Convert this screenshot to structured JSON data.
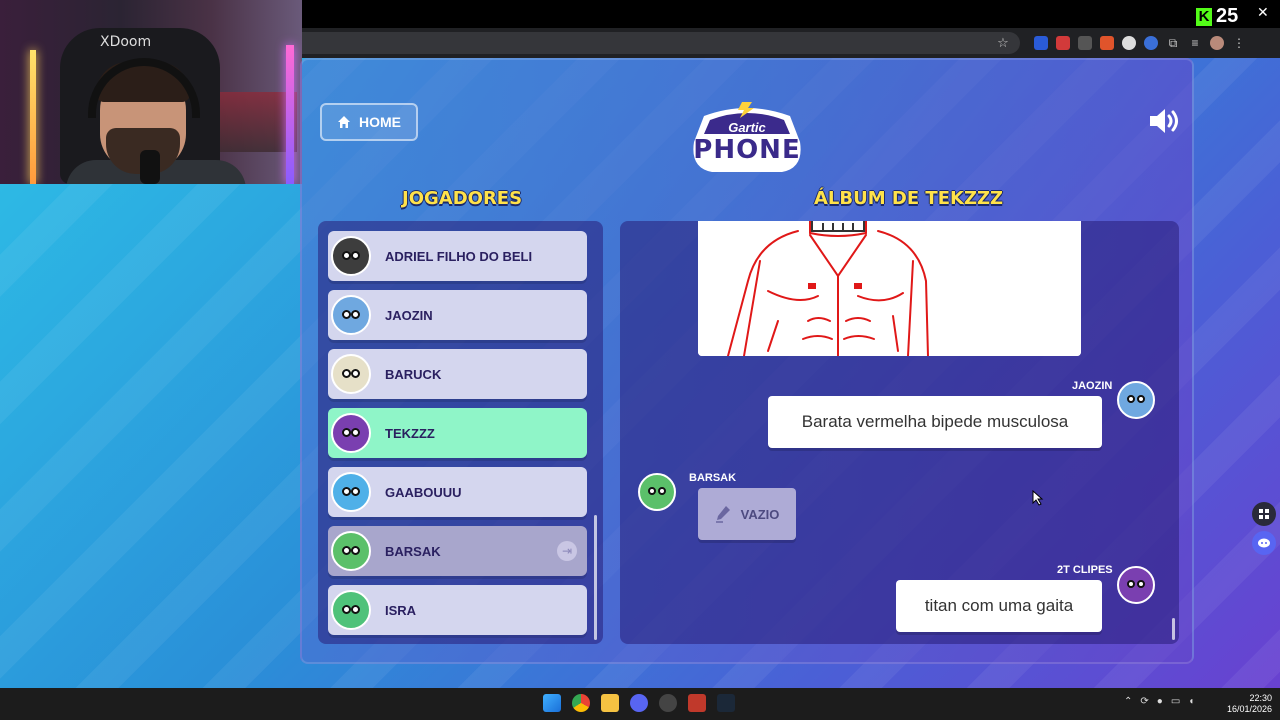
{
  "browser": {
    "kick_count": "25",
    "close_glyph": "✕"
  },
  "webcam": {
    "chair_brand": "XDoom"
  },
  "game": {
    "home_label": "HOME",
    "logo_top": "Gartic",
    "logo_main": "PHONE",
    "players_title": "JOGADORES",
    "album_title": "ÁLBUM DE TEKZZZ"
  },
  "players": [
    {
      "name": "ADRIEL FILHO DO BELI",
      "color": "#3d3d3d",
      "state": "normal"
    },
    {
      "name": "JAOZIN",
      "color": "#6fa8e0",
      "state": "normal"
    },
    {
      "name": "BARUCK",
      "color": "#e6e0c8",
      "state": "normal"
    },
    {
      "name": "TEKZZZ",
      "color": "#7a3fb0",
      "state": "active"
    },
    {
      "name": "GAABOUUU",
      "color": "#4fb0e8",
      "state": "normal"
    },
    {
      "name": "BARSAK",
      "color": "#5bc06a",
      "state": "disconnected"
    },
    {
      "name": "ISRA",
      "color": "#4fc27a",
      "state": "normal"
    }
  ],
  "album": {
    "messages": [
      {
        "author": "JAOZIN",
        "text": "Barata vermelha bipede musculosa"
      },
      {
        "author": "BARSAK",
        "text": "VAZIO"
      },
      {
        "author": "2T CLIPES",
        "text": "titan com uma gaita"
      }
    ]
  },
  "taskbar": {
    "time": "22:30",
    "date": "16/01/2026"
  }
}
